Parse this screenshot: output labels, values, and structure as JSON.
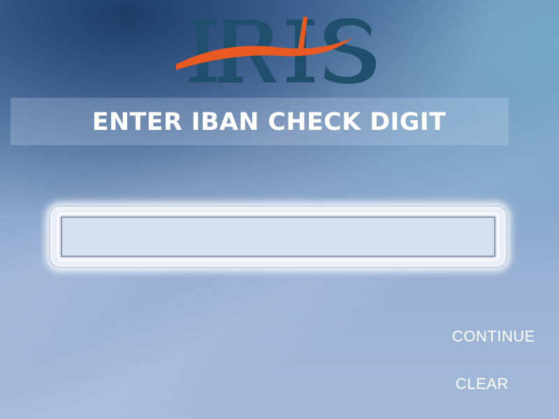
{
  "logo": {
    "text": "IRIS",
    "brand_color": "#1f4f6b",
    "swoosh_color": "#e85a22"
  },
  "header": {
    "title": "ENTER IBAN CHECK DIGIT"
  },
  "input": {
    "value": "",
    "placeholder": ""
  },
  "actions": {
    "continue_label": "CONTINUE",
    "clear_label": "CLEAR"
  }
}
